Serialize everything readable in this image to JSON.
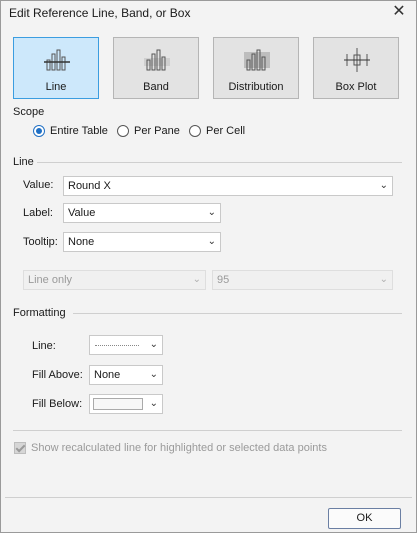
{
  "window": {
    "title": "Edit Reference Line, Band, or Box",
    "close_glyph": "✕"
  },
  "types": [
    {
      "label": "Line",
      "selected": true
    },
    {
      "label": "Band",
      "selected": false
    },
    {
      "label": "Distribution",
      "selected": false
    },
    {
      "label": "Box Plot",
      "selected": false
    }
  ],
  "scope": {
    "label": "Scope",
    "options": [
      {
        "label": "Entire Table",
        "selected": true
      },
      {
        "label": "Per Pane",
        "selected": false
      },
      {
        "label": "Per Cell",
        "selected": false
      }
    ]
  },
  "line": {
    "label": "Line",
    "value_label": "Value:",
    "value": "Round X",
    "label_label": "Label:",
    "label_value": "Value",
    "tooltip_label": "Tooltip:",
    "tooltip_value": "None",
    "line_mode": "Line only",
    "percent": "95"
  },
  "formatting": {
    "label": "Formatting",
    "line_label": "Line:",
    "fill_above_label": "Fill Above:",
    "fill_above_value": "None",
    "fill_below_label": "Fill Below:"
  },
  "recalc": {
    "label": "Show recalculated line for highlighted or selected data points",
    "checked": true
  },
  "buttons": {
    "ok": "OK"
  }
}
